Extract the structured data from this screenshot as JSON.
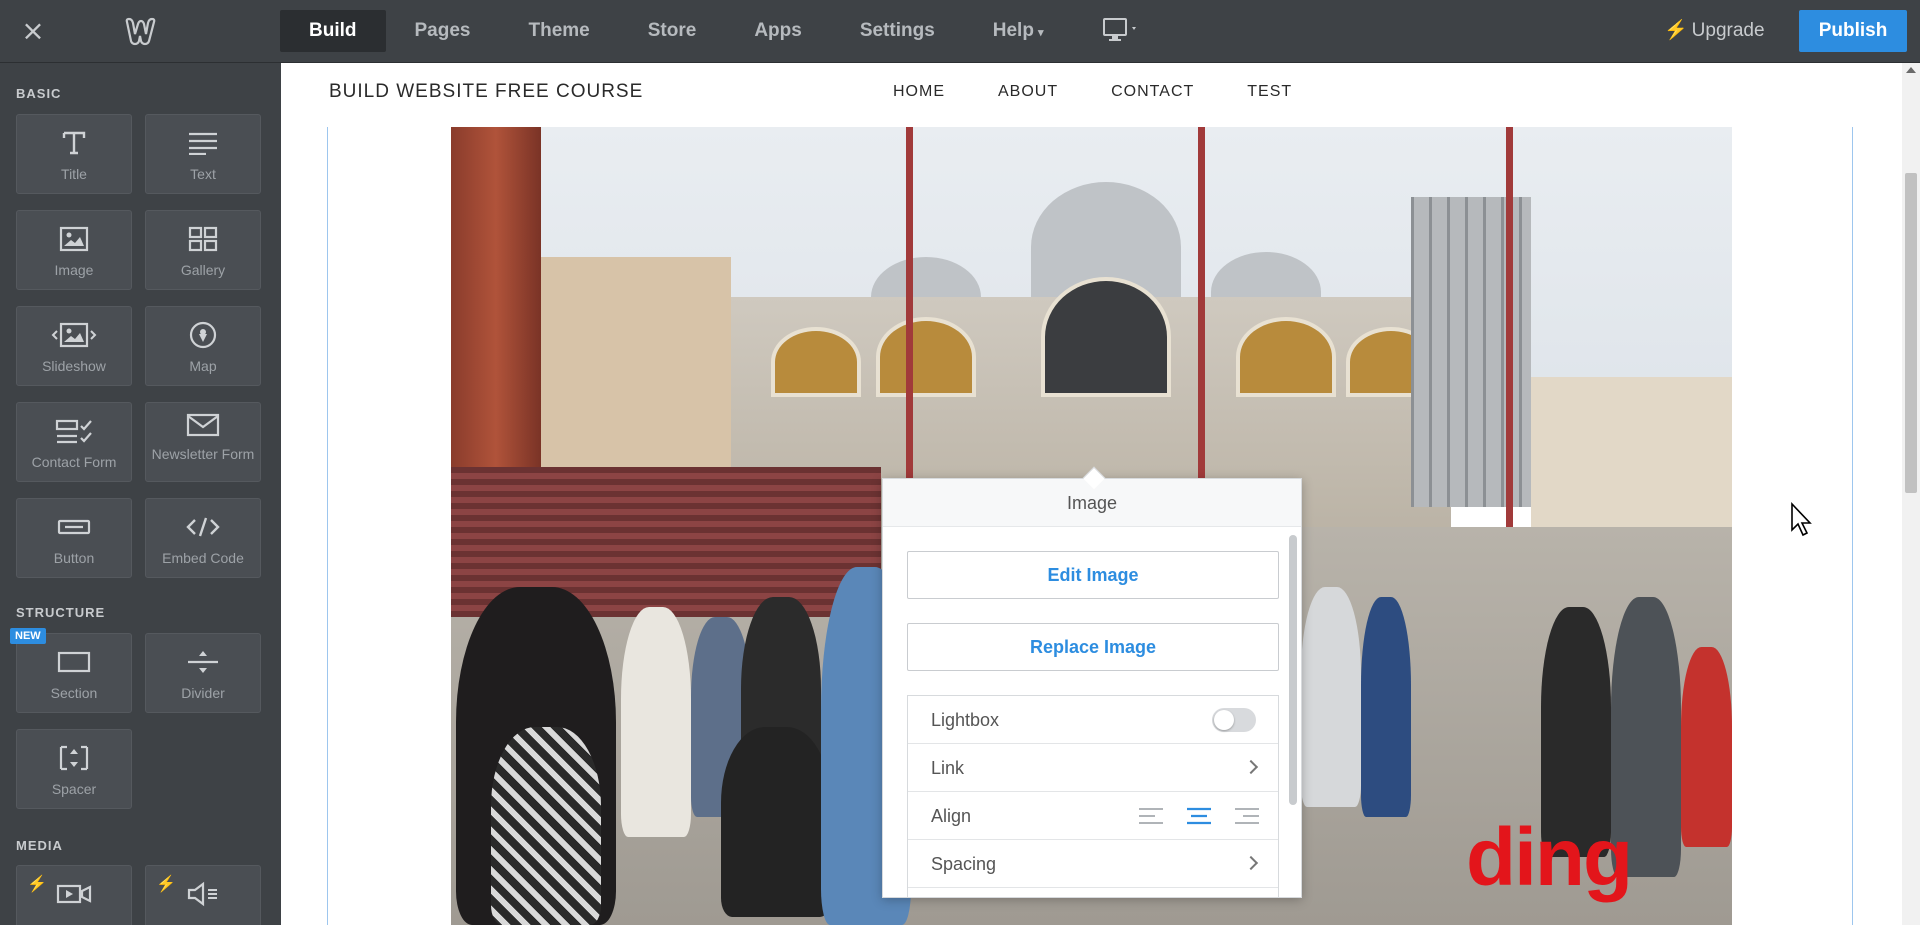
{
  "topbar": {
    "close_glyph": "×",
    "logo": "weebly-logo",
    "nav": [
      {
        "label": "Build",
        "active": true
      },
      {
        "label": "Pages"
      },
      {
        "label": "Theme"
      },
      {
        "label": "Store"
      },
      {
        "label": "Apps"
      },
      {
        "label": "Settings"
      },
      {
        "label": "Help",
        "caret": "▾"
      }
    ],
    "device_icon": "desktop-icon",
    "upgrade_label": "Upgrade",
    "publish_label": "Publish",
    "colors": {
      "bar": "#3e4246",
      "publish": "#2d8de0"
    }
  },
  "sidebar": {
    "sections": {
      "basic": "BASIC",
      "structure": "STRUCTURE",
      "media": "MEDIA"
    },
    "basic_items": [
      {
        "label": "Title",
        "icon": "title-icon"
      },
      {
        "label": "Text",
        "icon": "text-icon"
      },
      {
        "label": "Image",
        "icon": "image-icon"
      },
      {
        "label": "Gallery",
        "icon": "gallery-icon"
      },
      {
        "label": "Slideshow",
        "icon": "slideshow-icon"
      },
      {
        "label": "Map",
        "icon": "map-pin-icon"
      },
      {
        "label": "Contact Form",
        "icon": "contact-form-icon"
      },
      {
        "label": "Newsletter Form",
        "icon": "envelope-icon"
      },
      {
        "label": "Button",
        "icon": "button-icon"
      },
      {
        "label": "Embed Code",
        "icon": "code-icon"
      }
    ],
    "structure_items": [
      {
        "label": "Section",
        "icon": "section-icon",
        "badge": "NEW"
      },
      {
        "label": "Divider",
        "icon": "divider-icon"
      },
      {
        "label": "Spacer",
        "icon": "spacer-icon"
      }
    ],
    "media_items": [
      {
        "icon": "video-icon"
      },
      {
        "icon": "audio-icon"
      }
    ]
  },
  "site": {
    "title": "BUILD WEBSITE FREE COURSE",
    "nav": [
      "HOME",
      "ABOUT",
      "CONTACT",
      "TEST"
    ],
    "overlay_text": "ding"
  },
  "popup": {
    "title": "Image",
    "edit_label": "Edit Image",
    "replace_label": "Replace Image",
    "rows": {
      "lightbox": "Lightbox",
      "link": "Link",
      "align": "Align",
      "spacing": "Spacing"
    },
    "lightbox_on": false,
    "align_selected": "center",
    "accent": "#2d8de0"
  }
}
